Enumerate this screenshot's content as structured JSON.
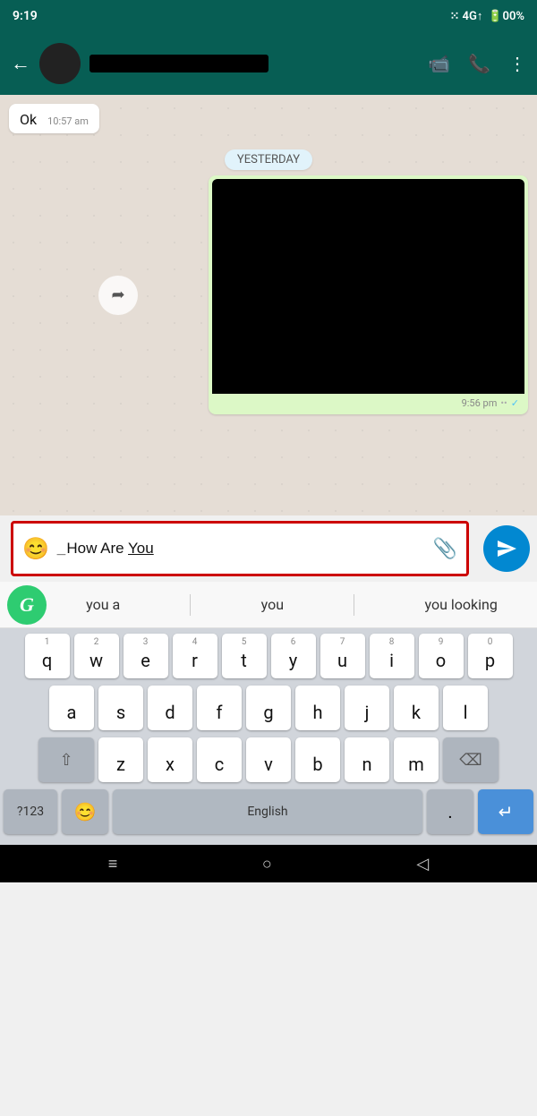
{
  "statusBar": {
    "time": "9:19",
    "signal": "4G",
    "battery": "00%"
  },
  "header": {
    "contactName": "[REDACTED]",
    "backLabel": "←"
  },
  "chat": {
    "messages": [
      {
        "type": "incoming",
        "text": "Ok",
        "time": "10:57 am"
      },
      {
        "type": "date",
        "label": "YESTERDAY"
      },
      {
        "type": "outgoing-video",
        "time": "9:56 pm"
      }
    ]
  },
  "inputBar": {
    "placeholder": "",
    "currentText": "_How Are You",
    "emojiIcon": "😊",
    "attachIcon": "📎"
  },
  "autocomplete": {
    "grammarly": "G",
    "suggestions": [
      "you a",
      "you",
      "you looking"
    ]
  },
  "keyboard": {
    "rows": [
      [
        "q",
        "w",
        "e",
        "r",
        "t",
        "y",
        "u",
        "i",
        "o",
        "p"
      ],
      [
        "a",
        "s",
        "d",
        "f",
        "g",
        "h",
        "j",
        "k",
        "l"
      ],
      [
        "z",
        "x",
        "c",
        "v",
        "b",
        "n",
        "m"
      ]
    ],
    "numbers": [
      "1",
      "2",
      "3",
      "4",
      "5",
      "6",
      "7",
      "8",
      "9",
      "0"
    ],
    "specialLeft": "?123",
    "comma": ",",
    "spaceLabel": "English",
    "period": ".",
    "shiftIcon": "⇧",
    "deleteIcon": "⌫",
    "enterIcon": "↵"
  },
  "navBar": {
    "homeIcon": "≡",
    "circleIcon": "○",
    "backIcon": "◁"
  }
}
